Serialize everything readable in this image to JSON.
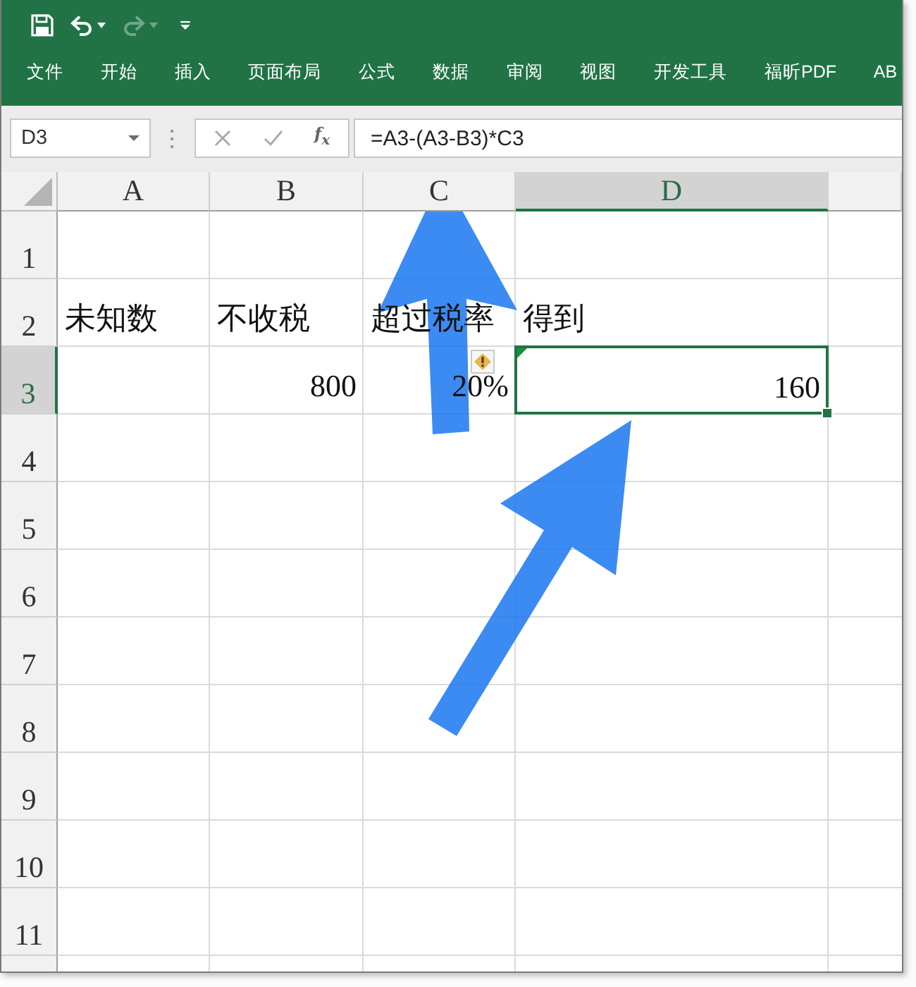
{
  "quick_access_toolbar": [
    {
      "kind": "save",
      "disabled": false
    },
    {
      "kind": "undo",
      "disabled": false
    },
    {
      "kind": "redo",
      "disabled": true
    },
    {
      "kind": "customize",
      "disabled": false
    }
  ],
  "ribbon_tabs": [
    {
      "label": "文件"
    },
    {
      "label": "开始"
    },
    {
      "label": "插入"
    },
    {
      "label": "页面布局"
    },
    {
      "label": "公式"
    },
    {
      "label": "数据"
    },
    {
      "label": "审阅"
    },
    {
      "label": "视图"
    },
    {
      "label": "开发工具"
    },
    {
      "label": "福昕PDF"
    },
    {
      "label": "AB"
    }
  ],
  "formula_bar": {
    "name_box": "D3",
    "function_button": "f$_{x}$",
    "formula": "=A3-(A3-B3)*C3"
  },
  "sheet": {
    "columns": [
      {
        "label": "A",
        "selected": false
      },
      {
        "label": "B",
        "selected": false
      },
      {
        "label": "C",
        "selected": false
      },
      {
        "label": "D",
        "selected": true
      },
      {
        "selected": false
      }
    ],
    "rows": [
      {
        "label": "1",
        "selected": false
      },
      {
        "label": "2",
        "selected": false,
        "cells": [
          {
            "text": "未知数",
            "kind": "text",
            "selected": false,
            "error_flag": false
          },
          {
            "text": "不收税",
            "kind": "text",
            "selected": false,
            "error_flag": false
          },
          {
            "text": "超过税率",
            "kind": "text",
            "selected": false,
            "error_flag": false
          },
          {
            "text": "得到",
            "kind": "text",
            "selected": false,
            "error_flag": false
          }
        ]
      },
      {
        "label": "3",
        "selected": true,
        "cells": [
          {
            "selected": false,
            "error_flag": false
          },
          {
            "text": "800",
            "kind": "number",
            "selected": false,
            "error_flag": false
          },
          {
            "text": "20%",
            "kind": "number",
            "selected": false,
            "error_flag": false
          },
          {
            "text": "160",
            "kind": "number",
            "selected": true,
            "error_flag": true
          }
        ]
      },
      {
        "label": "4",
        "selected": false
      },
      {
        "label": "5",
        "selected": false
      },
      {
        "label": "6",
        "selected": false
      },
      {
        "label": "7",
        "selected": false
      },
      {
        "label": "8",
        "selected": false
      },
      {
        "label": "9",
        "selected": false
      },
      {
        "label": "10",
        "selected": false
      },
      {
        "label": "11",
        "selected": false
      }
    ]
  }
}
